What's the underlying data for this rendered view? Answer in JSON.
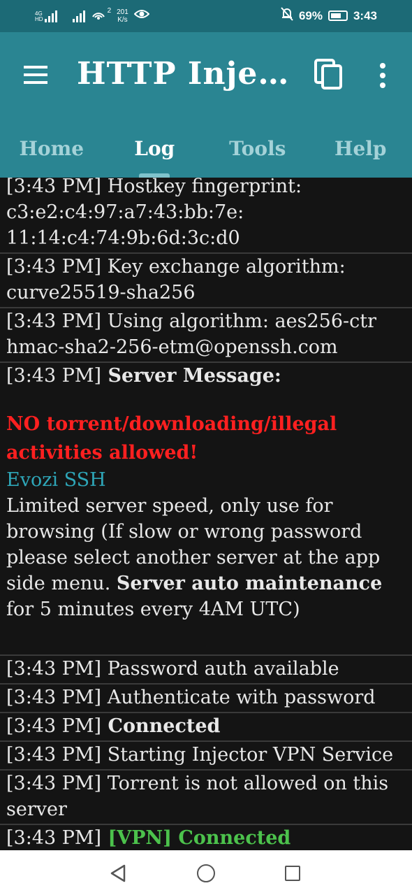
{
  "status_bar": {
    "network_label": "4G",
    "network_sublabel": "HD",
    "speed_value": "201",
    "speed_unit": "K/s",
    "hotspot_count": "2",
    "battery": "69%",
    "time": "3:43"
  },
  "app_bar": {
    "title": "HTTP Injec…"
  },
  "tabs": [
    {
      "label": "Home"
    },
    {
      "label": "Log"
    },
    {
      "label": "Tools"
    },
    {
      "label": "Help"
    }
  ],
  "log": {
    "e1": {
      "ts": "[3:43 PM]",
      "text": " Hostkey fingerprint:",
      "l2": "c3:e2:c4:97:a7:43:bb:7e:",
      "l3": "11:14:c4:74:9b:6d:3c:d0"
    },
    "e2": {
      "ts": "[3:43 PM]",
      "text": " Key exchange algorithm:",
      "l2": "curve25519-sha256"
    },
    "e3": {
      "ts": "[3:43 PM]",
      "text": " Using algorithm: aes256-ctr",
      "l2": "hmac-sha2-256-etm@openssh.com"
    },
    "e4": {
      "ts": "[3:43 PM]",
      "label": " Server Message:",
      "warning": "NO torrent/downloading/illegal activities allowed!",
      "brand": "Evozi SSH",
      "body_pre": "Limited server speed, only use for browsing (If slow or wrong password please select another server at the app side menu. ",
      "body_bold": "Server auto maintenance",
      "body_post": " for 5 minutes every 4AM UTC)"
    },
    "e5": {
      "ts": "[3:43 PM]",
      "text": " Password auth available"
    },
    "e6": {
      "ts": "[3:43 PM]",
      "text": " Authenticate with password"
    },
    "e7": {
      "ts": "[3:43 PM]",
      "text": " Connected"
    },
    "e8": {
      "ts": "[3:43 PM]",
      "text": " Starting Injector VPN Service"
    },
    "e9": {
      "ts": "[3:43 PM]",
      "text": " Torrent is not allowed on this server"
    },
    "e10": {
      "ts": "[3:43 PM]",
      "text": " [VPN] Connected"
    }
  },
  "colors": {
    "status_bar": "#1c6a76",
    "app_bar": "#2a8592",
    "log_bg": "#141414",
    "warning": "#ff2020",
    "brand": "#2ea6b8",
    "success": "#4cc24c"
  },
  "icons": [
    "signal-icon",
    "wifi-hotspot-icon",
    "eye-icon",
    "mute-bell-icon",
    "battery-icon",
    "menu-icon",
    "copy-icon",
    "more-vert-icon",
    "back-icon",
    "home-icon",
    "recents-icon"
  ]
}
